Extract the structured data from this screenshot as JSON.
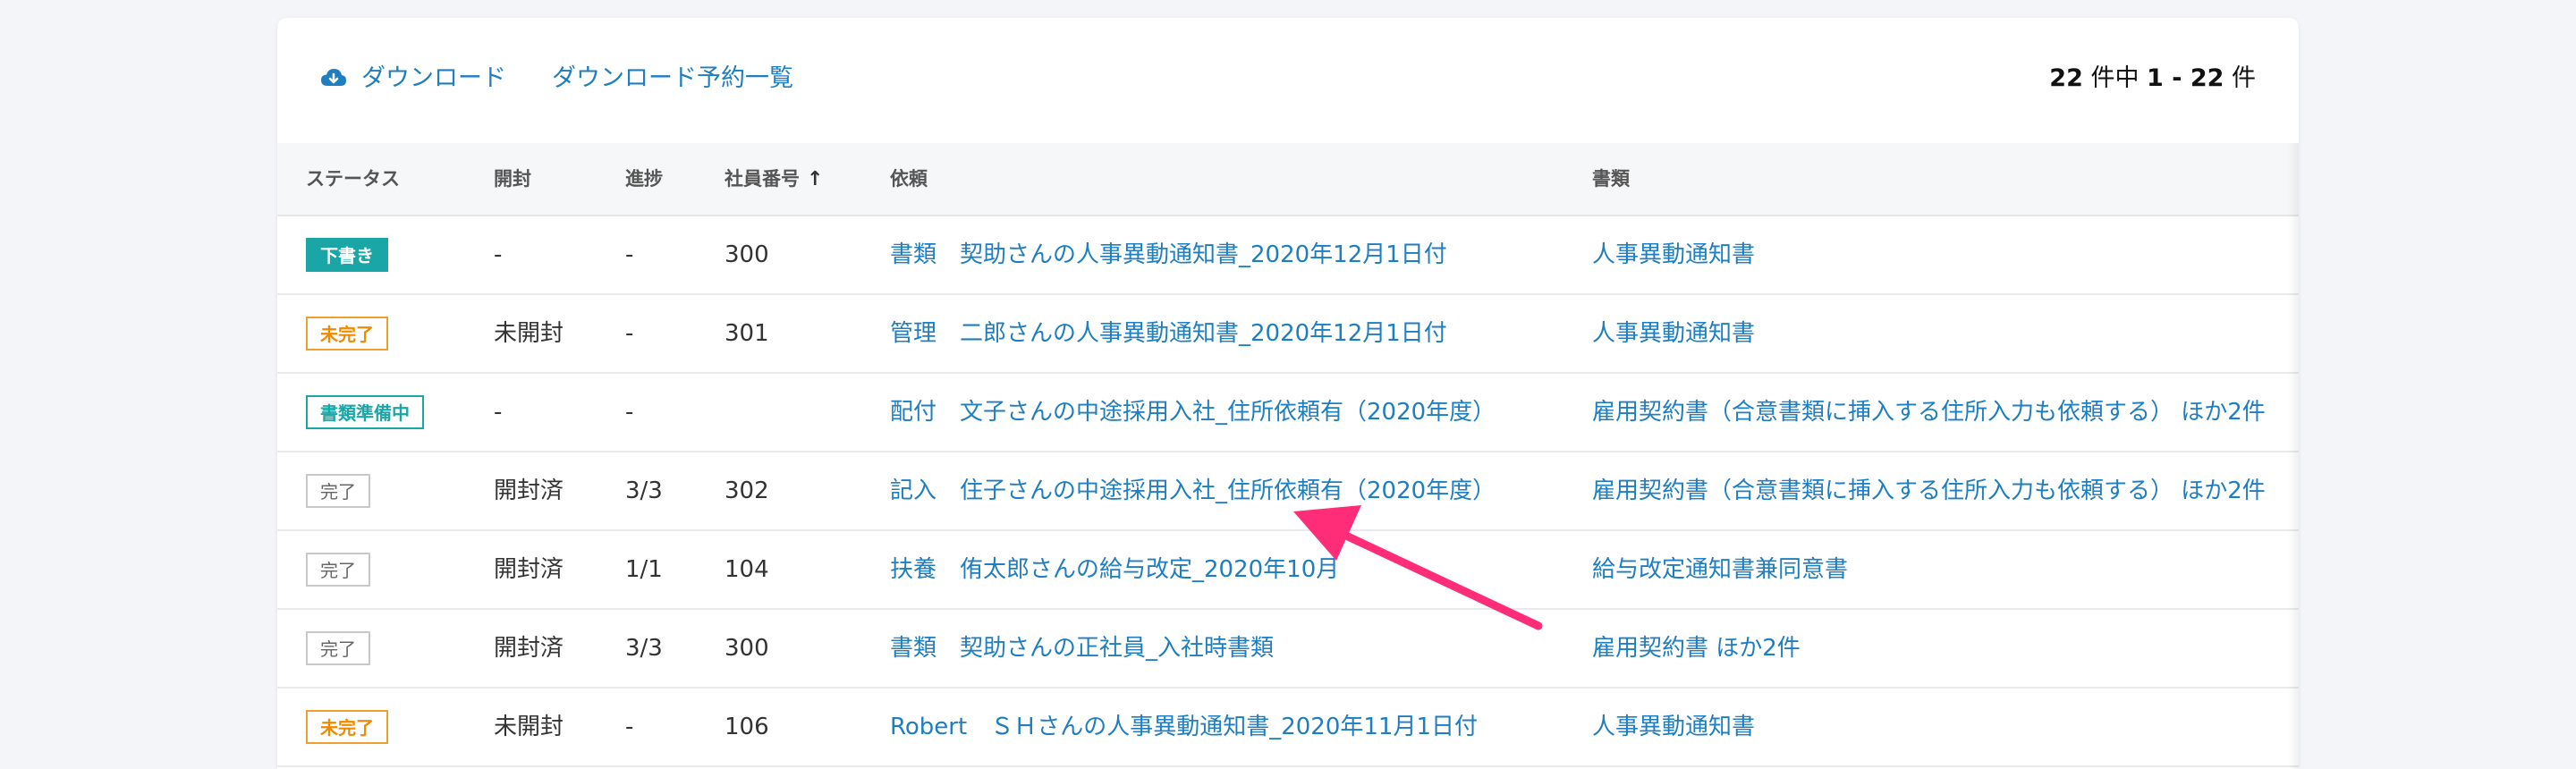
{
  "toolbar": {
    "download_label": "ダウンロード",
    "reservation_label": "ダウンロード予約一覧",
    "count_total": "22",
    "count_mid": " 件中 ",
    "count_range": "1 - 22",
    "count_suffix": " 件"
  },
  "columns": {
    "status": "ステータス",
    "opened": "開封",
    "progress": "進捗",
    "employee_no": "社員番号",
    "request": "依頼",
    "document": "書類",
    "sort_indicator": "↑"
  },
  "rows": [
    {
      "status": "下書き",
      "opened": "-",
      "progress": "-",
      "employee_no": "300",
      "request": "書類　契助さんの人事異動通知書_2020年12月1日付",
      "document": "人事異動通知書"
    },
    {
      "status": "未完了",
      "opened": "未開封",
      "progress": "-",
      "employee_no": "301",
      "request": "管理　二郎さんの人事異動通知書_2020年12月1日付",
      "document": "人事異動通知書"
    },
    {
      "status": "書類準備中",
      "opened": "-",
      "progress": "-",
      "employee_no": "",
      "request": "配付　文子さんの中途採用入社_住所依頼有（2020年度）",
      "document": "雇用契約書（合意書類に挿入する住所入力も依頼する） ほか2件"
    },
    {
      "status": "完了",
      "opened": "開封済",
      "progress": "3/3",
      "employee_no": "302",
      "request": "記入　住子さんの中途採用入社_住所依頼有（2020年度）",
      "document": "雇用契約書（合意書類に挿入する住所入力も依頼する） ほか2件"
    },
    {
      "status": "完了",
      "opened": "開封済",
      "progress": "1/1",
      "employee_no": "104",
      "request": "扶養　侑太郎さんの給与改定_2020年10月",
      "document": "給与改定通知書兼同意書"
    },
    {
      "status": "完了",
      "opened": "開封済",
      "progress": "3/3",
      "employee_no": "300",
      "request": "書類　契助さんの正社員_入社時書類",
      "document": "雇用契約書 ほか2件"
    },
    {
      "status": "未完了",
      "opened": "未開封",
      "progress": "-",
      "employee_no": "106",
      "request": "Robert　ＳＨさんの人事異動通知書_2020年11月1日付",
      "document": "人事異動通知書"
    }
  ],
  "colors": {
    "link": "#1f7ec0",
    "draft": "#1aa6a6",
    "incomplete": "#f08a00",
    "arrow": "#ff2d78"
  },
  "icons": {
    "download": "cloud-download-icon",
    "sort": "arrow-up-icon",
    "annotation": "pink-arrow-annotation"
  }
}
